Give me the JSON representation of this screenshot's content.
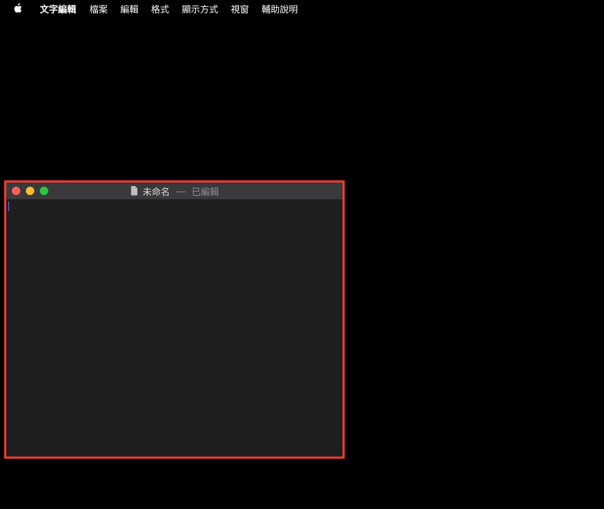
{
  "menubar": {
    "app_name": "文字編輯",
    "items": [
      "檔案",
      "編輯",
      "格式",
      "顯示方式",
      "視窗",
      "輔助說明"
    ]
  },
  "window": {
    "title": "未命名",
    "status": "已編輯",
    "separator": "—"
  }
}
